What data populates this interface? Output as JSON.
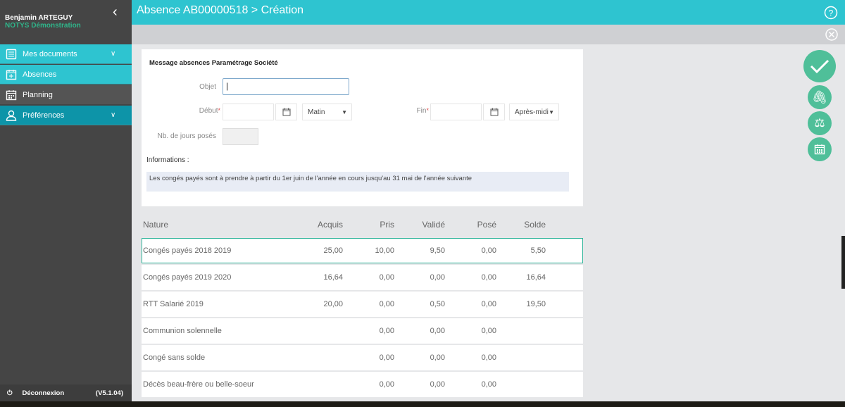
{
  "sidebar": {
    "user_name": "Benjamin ARTEGUY",
    "company": "NOTYS Démonstration",
    "items": [
      {
        "label": "Mes documents",
        "icon": "document-icon"
      },
      {
        "label": "Absences",
        "icon": "calendar-plus-icon"
      },
      {
        "label": "Planning",
        "icon": "calendar-icon"
      },
      {
        "label": "Préférences",
        "icon": "user-icon"
      }
    ],
    "logout": "Déconnexion",
    "version": "(V5.1.04)"
  },
  "header": {
    "title": "Absence AB00000518 > Création"
  },
  "form": {
    "title": "Message absences Paramétrage Société",
    "objet_label": "Objet",
    "objet_value": "",
    "debut_label": "Début",
    "debut_period": "Matin",
    "fin_label": "Fin",
    "fin_period": "Après-midi",
    "nb_jours_label": "Nb. de jours posés",
    "informations_label": "Informations :",
    "informations_text": "Les congés payés sont à prendre à partir du 1er juin de l'année en cours jusqu'au 31 mai de l'année suivante"
  },
  "table": {
    "headers": [
      "Nature",
      "Acquis",
      "Pris",
      "Validé",
      "Posé",
      "Solde"
    ],
    "rows": [
      [
        "Congés payés 2018 2019",
        "25,00",
        "10,00",
        "9,50",
        "0,00",
        "5,50"
      ],
      [
        "Congés payés 2019 2020",
        "16,64",
        "0,00",
        "0,00",
        "0,00",
        "16,64"
      ],
      [
        "RTT Salarié 2019",
        "20,00",
        "0,00",
        "0,50",
        "0,00",
        "19,50"
      ],
      [
        "Communion solennelle",
        "",
        "0,00",
        "0,00",
        "0,00",
        ""
      ],
      [
        "Congé sans solde",
        "",
        "0,00",
        "0,00",
        "0,00",
        ""
      ],
      [
        "Décès beau-frère ou belle-soeur",
        "",
        "0,00",
        "0,00",
        "0,00",
        ""
      ]
    ]
  },
  "colors": {
    "accent": "#2ec4d0",
    "action": "#4fbf99",
    "sidebar": "#454545"
  }
}
